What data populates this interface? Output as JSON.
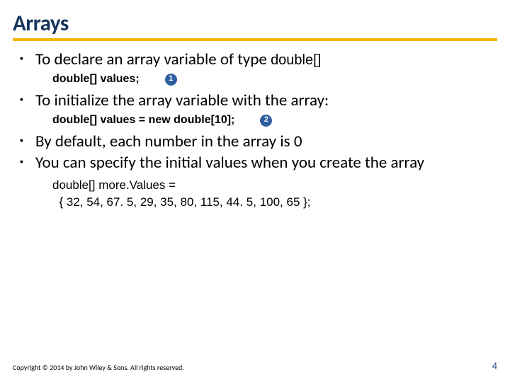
{
  "title": "Arrays",
  "bullets": {
    "b1_pre": "To declare an array variable of type ",
    "b1_type": "double[]",
    "code1": "double[] values;",
    "callout1": "1",
    "b2": "To initialize the array variable with the array:",
    "code2": "double[] values = new double[10];",
    "callout2": "2",
    "b3": "By default, each number in the array is 0",
    "b4": "You can specify the initial values when you create the array",
    "code3_l1": "double[] more.Values =",
    "code3_l2": "  { 32, 54, 67. 5, 29, 35, 80, 115, 44. 5, 100, 65 };"
  },
  "footer": {
    "copyright": "Copyright © 2014 by John Wiley & Sons. All rights reserved.",
    "page": "4"
  }
}
